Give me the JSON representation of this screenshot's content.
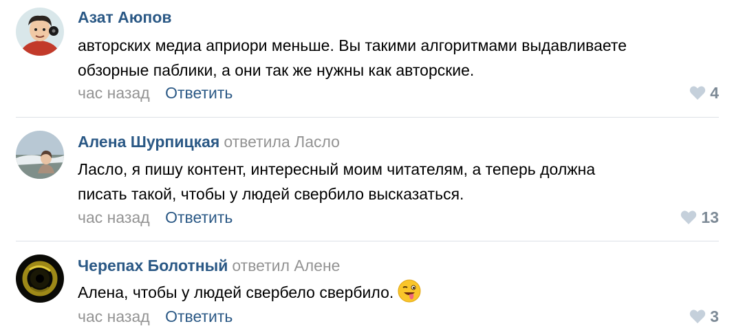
{
  "comments": [
    {
      "author": "Азат Аюпов",
      "reply_to": "",
      "text_lines": [
        "авторских медиа априори меньше. Вы такими алгоритмами выдавливаете",
        "обзорные паблики, а они так же нужны как авторские."
      ],
      "time": "час назад",
      "reply_label": "Ответить",
      "likes": "4"
    },
    {
      "author": "Алена Шурпицкая",
      "reply_to": "ответила Ласло",
      "text_lines": [
        "Ласло, я пишу контент, интересный моим читателям, а теперь должна",
        "писать такой, чтобы у людей свербило высказаться."
      ],
      "time": "час назад",
      "reply_label": "Ответить",
      "likes": "13"
    },
    {
      "author": "Черепах Болотный",
      "reply_to": "ответил Алене",
      "text_lines": [
        "Алена, чтобы у людей свербело свербило."
      ],
      "time": "час назад",
      "reply_label": "Ответить",
      "likes": "3",
      "emoji": "winking-tongue-emoji"
    }
  ],
  "colors": {
    "author": "#2a5885",
    "muted": "#939393",
    "like": "#7d8a96",
    "divider": "#dce1e6"
  },
  "icons": {
    "like": "heart-icon"
  }
}
